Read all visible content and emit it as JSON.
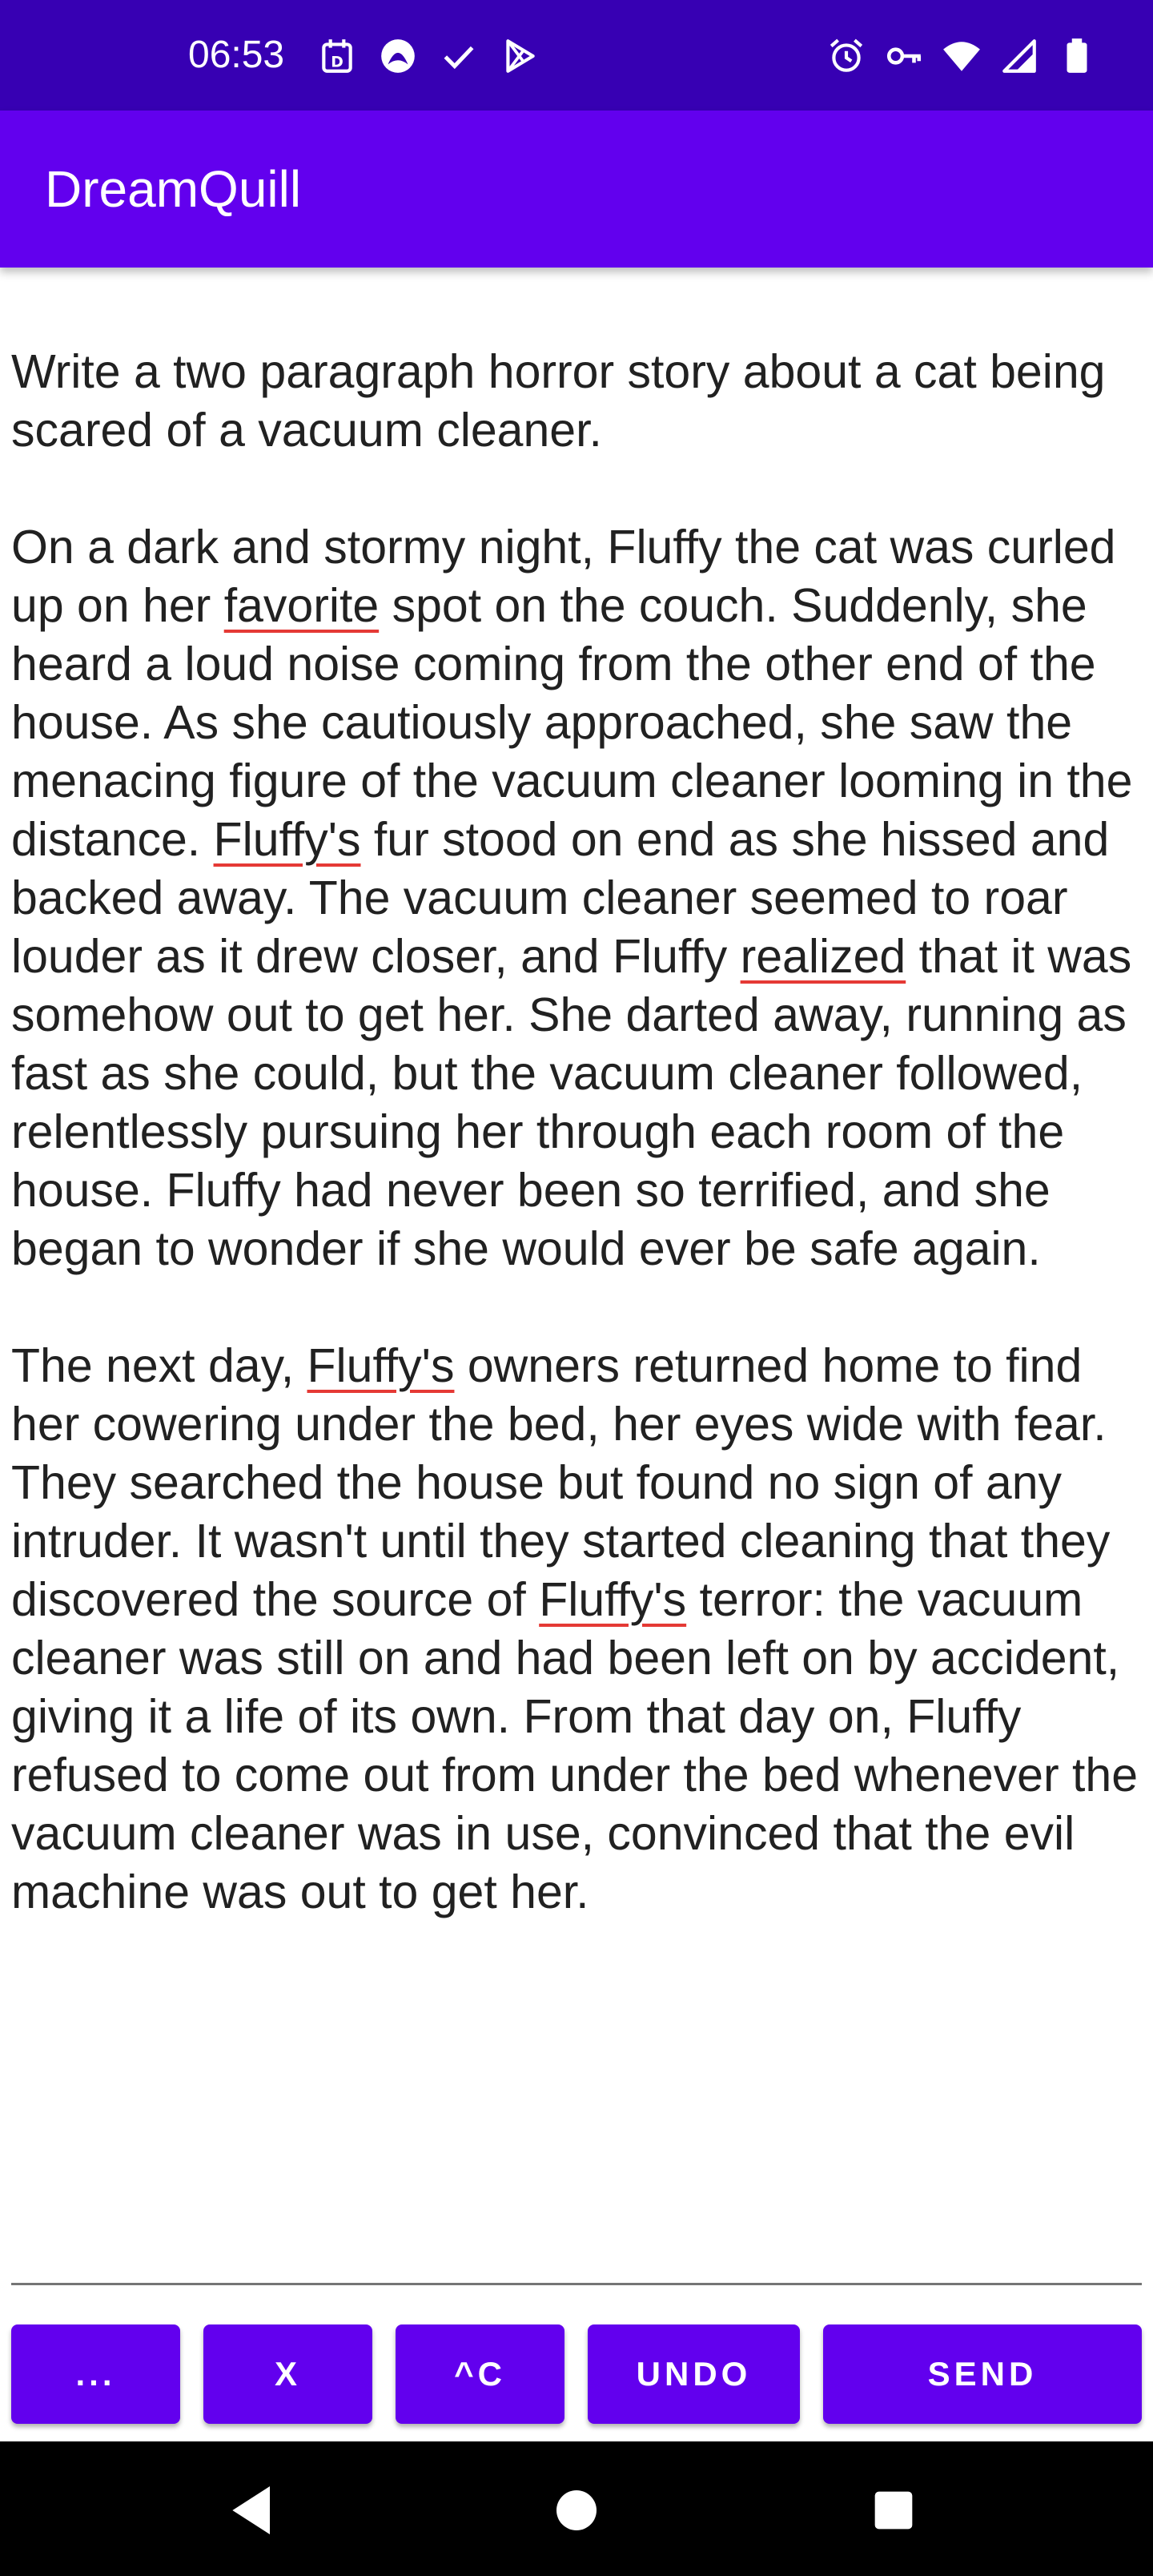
{
  "status_bar": {
    "time": "06:53",
    "left_icons": [
      "calendar-icon",
      "app-notification-icon",
      "check-icon",
      "play-store-icon"
    ],
    "right_icons": [
      "alarm-icon",
      "vpn-key-icon",
      "wifi-icon",
      "signal-icon",
      "battery-icon"
    ],
    "background": "#3700b3"
  },
  "app_bar": {
    "title": "DreamQuill",
    "background": "#6200ee"
  },
  "document": {
    "prompt": "Write a two paragraph horror story about a cat being scared of a vacuum cleaner.",
    "p1": {
      "a": "On a dark and stormy night, Fluffy the cat was curled up on her ",
      "u1": "favorite",
      "b": " spot on the couch. Suddenly, she heard a loud noise coming from the other end of the house. As she cautiously approached, she saw the menacing figure of the vacuum cleaner looming in the distance. ",
      "u2": "Fluffy's",
      "c": " fur stood on end as she hissed and backed away. The vacuum cleaner seemed to roar louder as it drew closer, and Fluffy ",
      "u3": "realized",
      "d": " that it was somehow out to get her. She darted away, running as fast as she could, but the vacuum cleaner followed, relentlessly pursuing her through each room of the house. Fluffy had never been so terrified, and she began to wonder if she would ever be safe again."
    },
    "p2": {
      "a": "The next day, ",
      "u1": "Fluffy's",
      "b": " owners returned home to find her cowering under the bed, her eyes wide with fear. They searched the house but found no sign of any intruder. It wasn't until they started cleaning that they discovered the source of ",
      "u2": "Fluffy's",
      "c": " terror: the vacuum cleaner was still on and had been left on by accident, giving it a life of its own. From that day on, Fluffy refused to come out from under the bed whenever the vacuum cleaner was in use, convinced that the evil machine was out to get her."
    },
    "spellcheck_color": "#e53935"
  },
  "buttons": {
    "more": "...",
    "clear": "X",
    "copy": "^C",
    "undo": "UNDO",
    "send": "SEND",
    "color": "#6200ee"
  },
  "nav_bar": {
    "icons": [
      "back-icon",
      "home-icon",
      "recents-icon"
    ]
  }
}
